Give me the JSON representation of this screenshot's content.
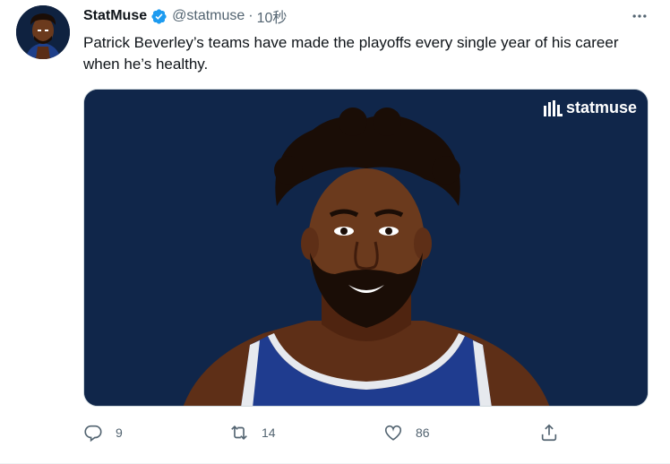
{
  "tweet": {
    "display_name": "StatMuse",
    "handle": "@statmuse",
    "separator": "·",
    "time": "10秒",
    "text": "Patrick Beverley’s teams have made the playoffs every single year of his career when he’s healthy.",
    "media": {
      "watermark": "statmuse"
    },
    "actions": {
      "replies": "9",
      "retweets": "14",
      "likes": "86"
    }
  },
  "colors": {
    "brand_blue": "#1d9bf0",
    "secondary_text": "#536471",
    "media_bg": "#10264a"
  },
  "icons": [
    "verified-badge-icon",
    "more-icon",
    "reply-icon",
    "retweet-icon",
    "like-icon",
    "share-icon",
    "statmuse-logo-icon"
  ]
}
